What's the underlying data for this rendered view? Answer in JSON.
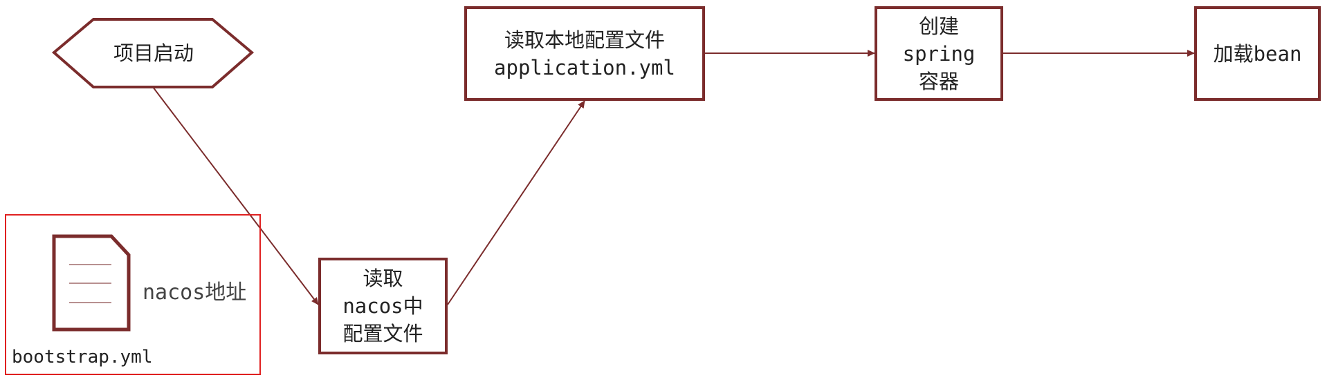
{
  "nodes": {
    "start": {
      "label": "项目启动"
    },
    "read_nacos": {
      "line1": "读取",
      "line2": "nacos中",
      "line3": "配置文件"
    },
    "read_local": {
      "line1": "读取本地配置文件",
      "line2": "application.yml"
    },
    "create_container": {
      "line1": "创建",
      "line2": "spring",
      "line3": "容器"
    },
    "load_bean": {
      "label": "加载bean"
    }
  },
  "bootstrap": {
    "file_name": "bootstrap.yml",
    "note": "nacos地址"
  },
  "colors": {
    "node_border": "#7b2c2c",
    "highlight_box": "#e02020",
    "document_lines": "#a06b6b"
  },
  "icons": [
    "document-icon"
  ]
}
